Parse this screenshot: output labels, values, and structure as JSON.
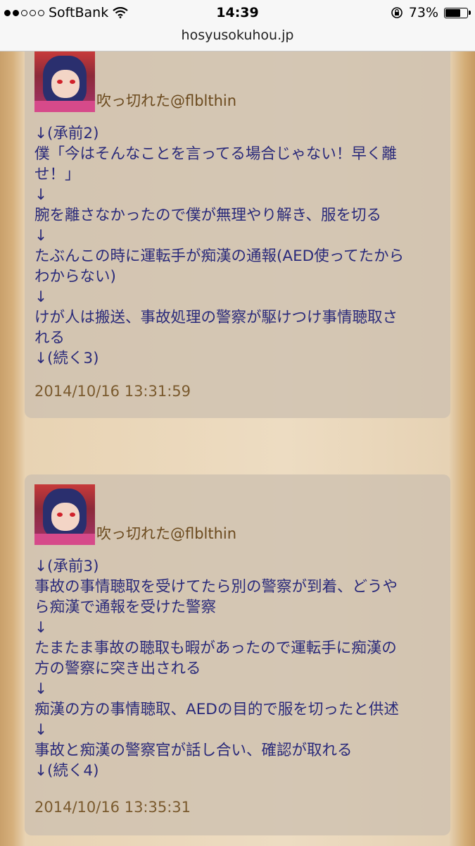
{
  "status": {
    "carrier": "SoftBank",
    "time": "14:39",
    "battery": "73%",
    "battery_level": 0.73,
    "signal_bars": 2,
    "signal_total": 5
  },
  "browser": {
    "url": "hosyusokuhou.jp"
  },
  "posts": [
    {
      "author": "吹っ切れた@flblthin",
      "lines": [
        "↓(承前2)",
        "僕「今はそんなことを言ってる場合じゃない！早く離",
        "せ！」",
        "↓",
        "腕を離さなかったので僕が無理やり解き、服を切る",
        "↓",
        "たぶんこの時に運転手が痴漢の通報(AED使ってたから",
        "わからない)",
        "↓",
        "けが人は搬送、事故処理の警察が駆けつけ事情聴取さ",
        "れる",
        "↓(続く3)"
      ],
      "timestamp": "2014/10/16 13:31:59"
    },
    {
      "author": "吹っ切れた@flblthin",
      "lines": [
        "↓(承前3)",
        "事故の事情聴取を受けてたら別の警察が到着、どうや",
        "ら痴漢で通報を受けた警察",
        "↓",
        "たまたま事故の聴取も暇があったので運転手に痴漢の",
        "方の警察に突き出される",
        "↓",
        "痴漢の方の事情聴取、AEDの目的で服を切ったと供述",
        "↓",
        "事故と痴漢の警察官が話し合い、確認が取れる",
        "↓(続く4)"
      ],
      "timestamp": "2014/10/16 13:35:31"
    }
  ]
}
